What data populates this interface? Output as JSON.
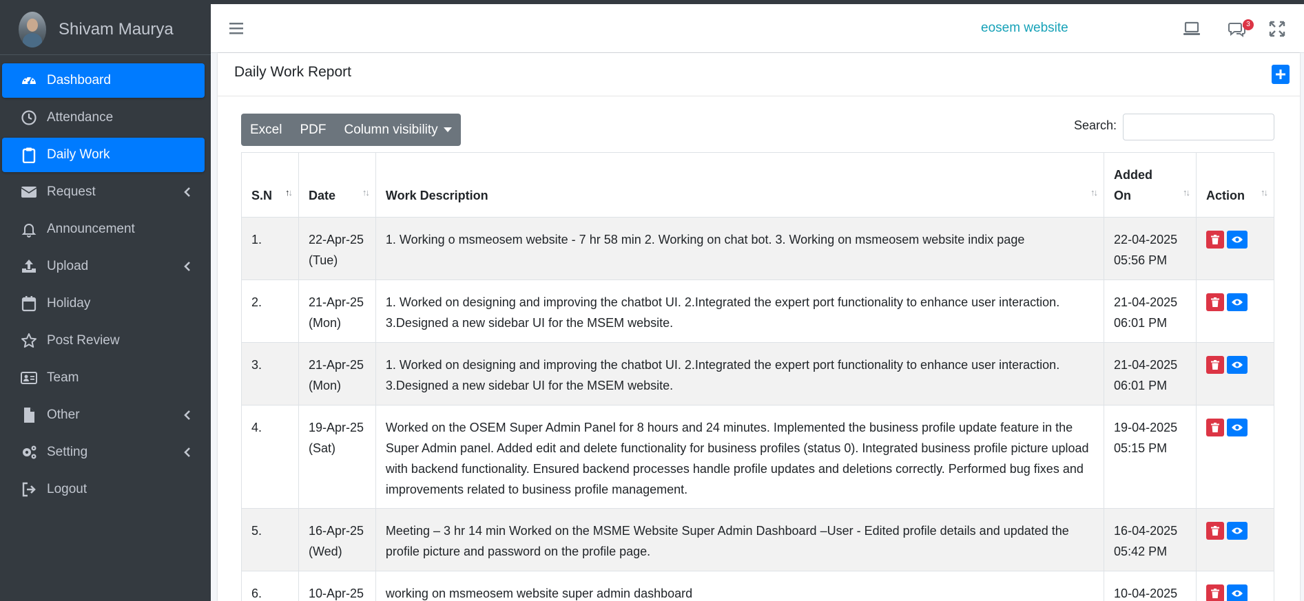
{
  "user": {
    "name": "Shivam Maurya"
  },
  "sidebar": {
    "items": [
      {
        "label": "Dashboard",
        "icon": "gauge-icon",
        "active": true,
        "arrow": false
      },
      {
        "label": "Attendance",
        "icon": "clock-icon",
        "active": false,
        "arrow": false
      },
      {
        "label": "Daily Work",
        "icon": "clipboard-icon",
        "active": true,
        "arrow": false
      },
      {
        "label": "Request",
        "icon": "envelope-icon",
        "active": false,
        "arrow": true
      },
      {
        "label": "Announcement",
        "icon": "bell-icon",
        "active": false,
        "arrow": false
      },
      {
        "label": "Upload",
        "icon": "upload-icon",
        "active": false,
        "arrow": true
      },
      {
        "label": "Holiday",
        "icon": "calendar-icon",
        "active": false,
        "arrow": false
      },
      {
        "label": "Post Review",
        "icon": "star-icon",
        "active": false,
        "arrow": false
      },
      {
        "label": "Team",
        "icon": "id-card-icon",
        "active": false,
        "arrow": false
      },
      {
        "label": "Other",
        "icon": "file-icon",
        "active": false,
        "arrow": true
      },
      {
        "label": "Setting",
        "icon": "gears-icon",
        "active": false,
        "arrow": true
      },
      {
        "label": "Logout",
        "icon": "logout-icon",
        "active": false,
        "arrow": false
      }
    ]
  },
  "header": {
    "site_link": "eosem website",
    "notification_count": "3"
  },
  "card": {
    "title": "Daily Work Report"
  },
  "toolbar": {
    "excel": "Excel",
    "pdf": "PDF",
    "column_visibility": "Column visibility",
    "search_label": "Search:",
    "search_value": ""
  },
  "table": {
    "headers": {
      "sn": "S.N",
      "date": "Date",
      "description": "Work Description",
      "added_on_line1": "Added",
      "added_on_line2": "On",
      "action": "Action"
    },
    "rows": [
      {
        "sn": "1.",
        "date": "22-Apr-25",
        "day": "(Tue)",
        "description": "1. Working o msmeosem website - 7 hr 58 min 2. Working on chat bot. 3. Working on msmeosem website indix page",
        "added_date": "22-04-2025",
        "added_time": "05:56 PM"
      },
      {
        "sn": "2.",
        "date": "21-Apr-25",
        "day": "(Mon)",
        "description": "1. Worked on designing and improving the chatbot UI. 2.Integrated the expert port functionality to enhance user interaction. 3.Designed a new sidebar UI for the MSEM website.",
        "added_date": "21-04-2025",
        "added_time": "06:01 PM"
      },
      {
        "sn": "3.",
        "date": "21-Apr-25",
        "day": "(Mon)",
        "description": "1. Worked on designing and improving the chatbot UI. 2.Integrated the expert port functionality to enhance user interaction. 3.Designed a new sidebar UI for the MSEM website.",
        "added_date": "21-04-2025",
        "added_time": "06:01 PM"
      },
      {
        "sn": "4.",
        "date": "19-Apr-25",
        "day": "(Sat)",
        "description": "Worked on the OSEM Super Admin Panel for 8 hours and 24 minutes. Implemented the business profile update feature in the Super Admin panel. Added edit and delete functionality for business profiles (status 0). Integrated business profile picture upload with backend functionality. Ensured backend processes handle profile updates and deletions correctly. Performed bug fixes and improvements related to business profile management.",
        "added_date": "19-04-2025",
        "added_time": "05:15 PM"
      },
      {
        "sn": "5.",
        "date": "16-Apr-25",
        "day": "(Wed)",
        "description": "Meeting – 3 hr 14 min Worked on the MSME Website Super Admin Dashboard –User - Edited profile details and updated the profile picture and password on the profile page.",
        "added_date": "16-04-2025",
        "added_time": "05:42 PM"
      },
      {
        "sn": "6.",
        "date": "10-Apr-25",
        "day": "",
        "description": "working on msmeosem website super admin dashboard",
        "added_date": "10-04-2025",
        "added_time": ""
      }
    ]
  },
  "colors": {
    "sidebar_bg": "#343a40",
    "primary": "#007bff",
    "danger": "#dc3545",
    "link": "#17a2b8",
    "btn_secondary": "#6c757d"
  }
}
